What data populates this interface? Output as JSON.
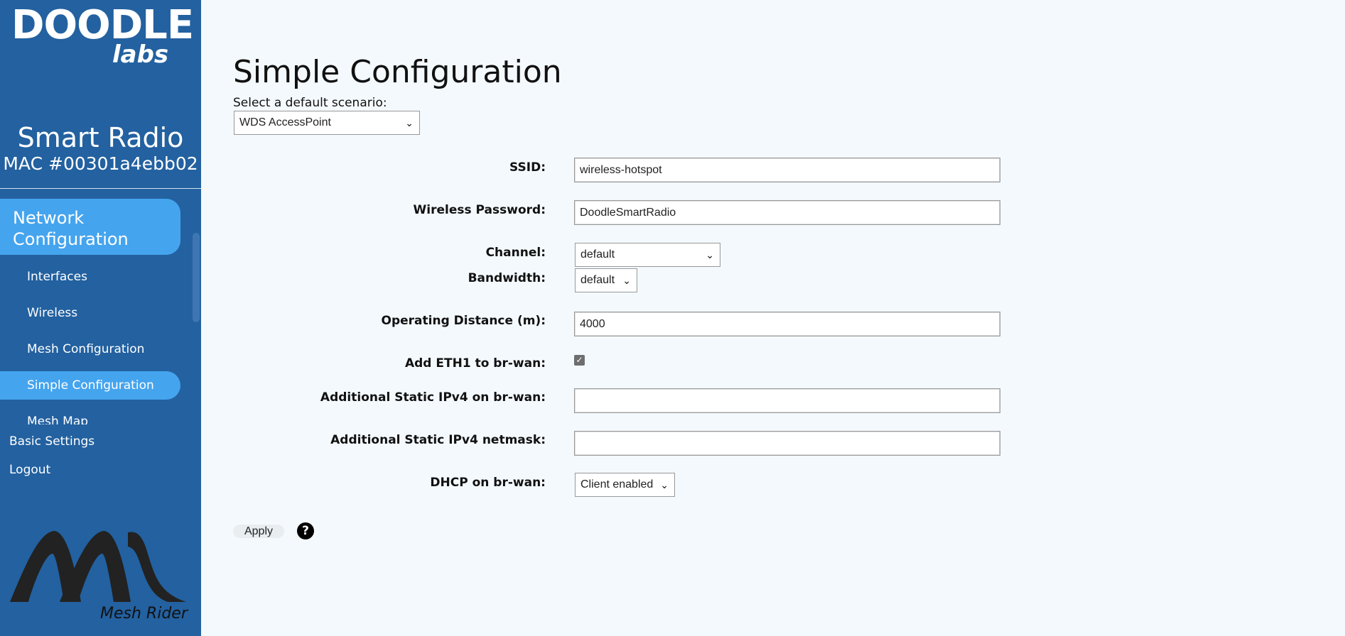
{
  "brand": {
    "logo_main": "DOODLE",
    "logo_sub": "labs",
    "device_name": "Smart Radio",
    "mac": "MAC #00301a4ebb02",
    "product_logo_text": "Mesh Rider"
  },
  "sidebar": {
    "section_title": "Network Configuration",
    "items": [
      {
        "label": "Interfaces"
      },
      {
        "label": "Wireless"
      },
      {
        "label": "Mesh Configuration"
      },
      {
        "label": "Simple Configuration",
        "active": true
      },
      {
        "label": "Mesh Map"
      }
    ],
    "links": [
      {
        "label": "Basic Settings"
      },
      {
        "label": "Logout"
      }
    ],
    "colors": {
      "background": "#2361a0",
      "active": "#45a4ee"
    }
  },
  "main": {
    "title": "Simple Configuration",
    "scenario_label": "Select a default scenario:",
    "scenario_value": "WDS AccessPoint",
    "fields": {
      "ssid": {
        "label": "SSID:",
        "value": "wireless-hotspot"
      },
      "password": {
        "label": "Wireless Password:",
        "value": "DoodleSmartRadio"
      },
      "channel": {
        "label": "Channel:",
        "value": "default"
      },
      "bandwidth": {
        "label": "Bandwidth:",
        "value": "default"
      },
      "distance": {
        "label": "Operating Distance (m):",
        "value": "4000"
      },
      "eth1": {
        "label": "Add ETH1 to br-wan:",
        "checked": true
      },
      "static_ip": {
        "label": "Additional Static IPv4 on br-wan:",
        "value": ""
      },
      "static_mask": {
        "label": "Additional Static IPv4 netmask:",
        "value": ""
      },
      "dhcp": {
        "label": "DHCP on br-wan:",
        "value": "Client enabled"
      }
    },
    "apply_label": "Apply",
    "help_icon": "help-circle-icon"
  }
}
